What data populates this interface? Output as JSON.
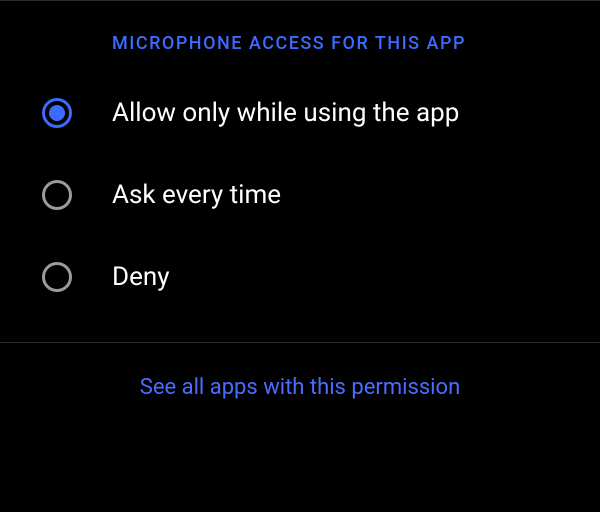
{
  "header": {
    "title": "MICROPHONE ACCESS FOR THIS APP"
  },
  "options": [
    {
      "label": "Allow only while using the app",
      "selected": true
    },
    {
      "label": "Ask every time",
      "selected": false
    },
    {
      "label": "Deny",
      "selected": false
    }
  ],
  "footer": {
    "link_label": "See all apps with this permission"
  },
  "colors": {
    "accent": "#3c6cff",
    "link": "#4a6cff"
  }
}
